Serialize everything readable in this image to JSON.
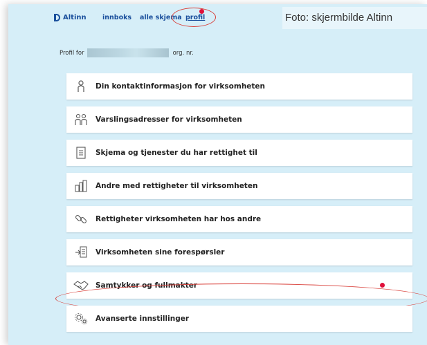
{
  "header": {
    "logo_text": "Altinn",
    "nav": [
      {
        "label": "innboks"
      },
      {
        "label": "alle skjema"
      },
      {
        "label": "profil",
        "active": true
      }
    ],
    "caption": "Foto: skjermbilde Altinn"
  },
  "profile": {
    "prefix": "Profil for",
    "suffix": "org. nr."
  },
  "menu": [
    {
      "label": "Din kontaktinformasjon for virksomheten",
      "icon": "person-icon"
    },
    {
      "label": "Varslingsadresser for virksomheten",
      "icon": "people-icon"
    },
    {
      "label": "Skjema og tjenester du har rettighet til",
      "icon": "document-icon"
    },
    {
      "label": "Andre med rettigheter til virksomheten",
      "icon": "building-icon"
    },
    {
      "label": "Rettigheter virksomheten har hos andre",
      "icon": "link-icon"
    },
    {
      "label": "Virksomheten sine forespørsler",
      "icon": "request-icon"
    },
    {
      "label": "Samtykker og fullmakter",
      "icon": "handshake-icon",
      "notification": true
    },
    {
      "label": "Avanserte innstillinger",
      "icon": "gears-icon"
    }
  ],
  "colors": {
    "background": "#d6eef8",
    "brand": "#1a4f9c",
    "highlight_circle": "#d9403a",
    "notification": "#e0103a"
  }
}
